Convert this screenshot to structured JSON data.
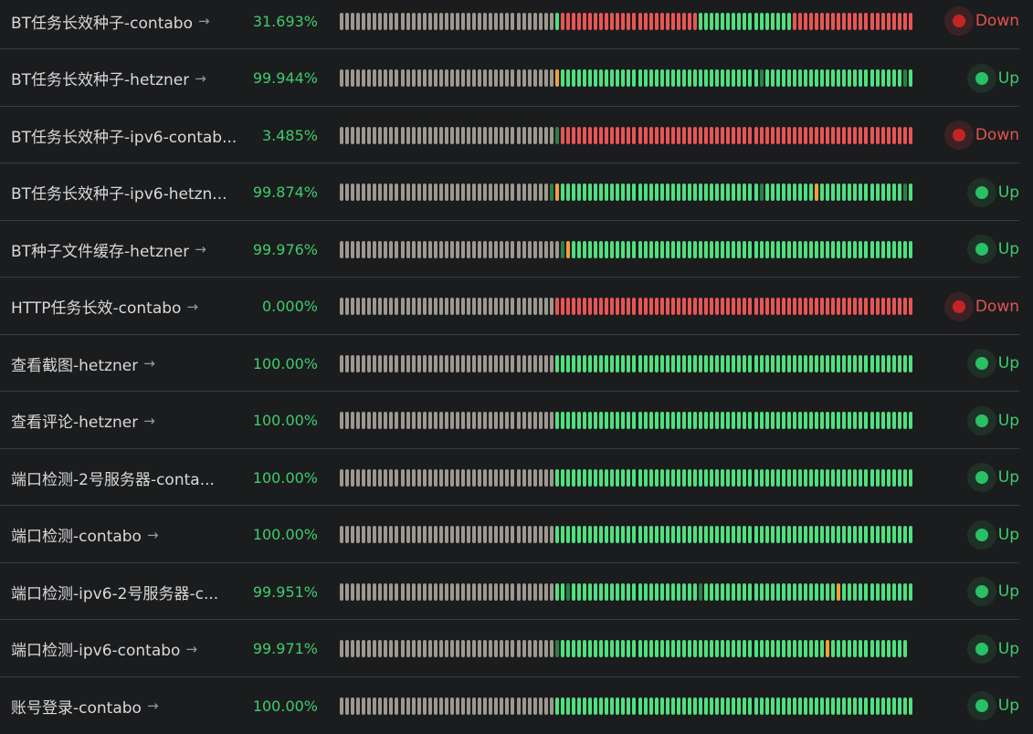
{
  "colors": {
    "up": "#4fe07f",
    "down": "#e85555",
    "pending": "#f0a03a",
    "empty": "#9d9890",
    "maintenance": "#2f7d48",
    "background": "#1b1c1e"
  },
  "arrow_icon": "→",
  "monitors": [
    {
      "name": "BT任务长效种子-contabo",
      "uptime": "31.693%",
      "status": "Down",
      "state": "down",
      "beats": "EEEEEEEEEEEEEEEEEEEEEEEEEEEEEEEEEEEEEEEUDDDDDDDDDDDDDDDDDDDDDDDDDUUUUUUUUUUUUUUUUUDDDDDDDDDDDDDDDDDDDDDDD"
    },
    {
      "name": "BT任务长效种子-hetzner",
      "uptime": "99.944%",
      "status": "Up",
      "state": "up",
      "beats": "EEEEEEEEEEEEEEEEEEEEEEEEEEEEEEEEEEEEEEEPUUUUUUUUUUUUUUUUUUUUUUUUUUUUUUUUUUUUMUUUUUUUUUUUUUUUUUUUUUUUUUMU"
    },
    {
      "name": "BT任务长效种子-ipv6-contab...",
      "uptime": "3.485%",
      "status": "Down",
      "state": "down",
      "beats": "EEEEEEEEEEEEEEEEEEEEEEEEEEEEEEEEEEEEEEEMDDDDDDDDDDDDDDDDDDDDDDDDDDDDDDDDDDDDDDDDDDDDDDDDDDDDDDDDDDDDDDDDD"
    },
    {
      "name": "BT任务长效种子-ipv6-hetzn...",
      "uptime": "99.874%",
      "status": "Up",
      "state": "up",
      "beats": "EEEEEEEEEEEEEEEEEEEEEEEEEEEEEEEEEEEEEEMPUUUUUUUUUUUUUUUUUUUUUUUUUUUUUUUUUUUUMUUUUUUUUUPUUUUUUUUUUUUUUUMU"
    },
    {
      "name": "BT种子文件缓存-hetzner",
      "uptime": "99.976%",
      "status": "Up",
      "state": "up",
      "beats": "EEEEEEEEEEEEEEEEEEEEEEEEEEEEEEEEEEEEEEEEMPUUUUUUUUUUUUUUUUUUUUUUUUUUUUUUUUUUUUUUUUUUUUUUUUUUUUUUUUUUUUUU"
    },
    {
      "name": "HTTP任务长效-contabo",
      "uptime": "0.000%",
      "status": "Down",
      "state": "down",
      "beats": "EEEEEEEEEEEEEEEEEEEEEEEEEEEEEEEEEEEEEEEDDDDDDDDDDDDDDDDDDDDDDDDDDDDDDDDDDDDDDDDDDDDDDDDDDDDDDDDDDDDDDDDDD"
    },
    {
      "name": "查看截图-hetzner",
      "uptime": "100.00%",
      "status": "Up",
      "state": "up",
      "beats": "EEEEEEEEEEEEEEEEEEEEEEEEEEEEEEEEEEEEEEEUUUUUUUUUUUUUUUUUUUUUUUUUUUUUUUUUUUUUUUUUUUUUUUUUUUUUUUUUUUUUUUUU"
    },
    {
      "name": "查看评论-hetzner",
      "uptime": "100.00%",
      "status": "Up",
      "state": "up",
      "beats": "EEEEEEEEEEEEEEEEEEEEEEEEEEEEEEEEEEEEEEEUUUUUUUUUUUUUUUUUUUUUUUUUUUUUUUUUUUUUUUUUUUUUUUUUUUUUUUUUUUUUUUUU"
    },
    {
      "name": "端口检测-2号服务器-conta...",
      "uptime": "100.00%",
      "status": "Up",
      "state": "up",
      "beats": "EEEEEEEEEEEEEEEEEEEEEEEEEEEEEEEEEEEEEEEUUUUUUUUUUUUUUUUUUUUUUUUUUUUUUUUUUUUUUUUUUUUUUUUUUUUUUUUUUUUUUUUU"
    },
    {
      "name": "端口检测-contabo",
      "uptime": "100.00%",
      "status": "Up",
      "state": "up",
      "beats": "EEEEEEEEEEEEEEEEEEEEEEEEEEEEEEEEEEEEEEEUUUUUUUUUUUUUUUUUUUUUUUUUUUUUUUUUUUUUUUUUUUUUUUUUUUUUUUUUUUUUUUUU"
    },
    {
      "name": "端口检测-ipv6-2号服务器-c...",
      "uptime": "99.951%",
      "status": "Up",
      "state": "up",
      "beats": "EEEEEEEEEEEEEEEEEEEEEEEEEEEEEEEEEEEEEEEUUMUUUUUUUUUUUUUUUUUUUUUUUMUUUUUUUUUUUUUUUUUUUUUUUUPUUUUUUUUUUUUU"
    },
    {
      "name": "端口检测-ipv6-contabo",
      "uptime": "99.971%",
      "status": "Up",
      "state": "up",
      "beats": "EEEEEEEEEEEEEEEEEEEEEEEEEEEEEEEEEEEEEEEMUUUUUUUUUUUUUUUUUUUUUUUUUUUUUUUUUUUUUUUUUUUUUUUUPUUUUUUUUUUUUUU"
    },
    {
      "name": "账号登录-contabo",
      "uptime": "100.00%",
      "status": "Up",
      "state": "up",
      "beats": "EEEEEEEEEEEEEEEEEEEEEEEEEEEEEEEEEEEEEEEUUUUUUUUUUUUUUUUUUUUUUUUUUUUUUUUUUUUUUUUUUUUUUUUUUUUUUUUUUUUUUUUU"
    }
  ]
}
